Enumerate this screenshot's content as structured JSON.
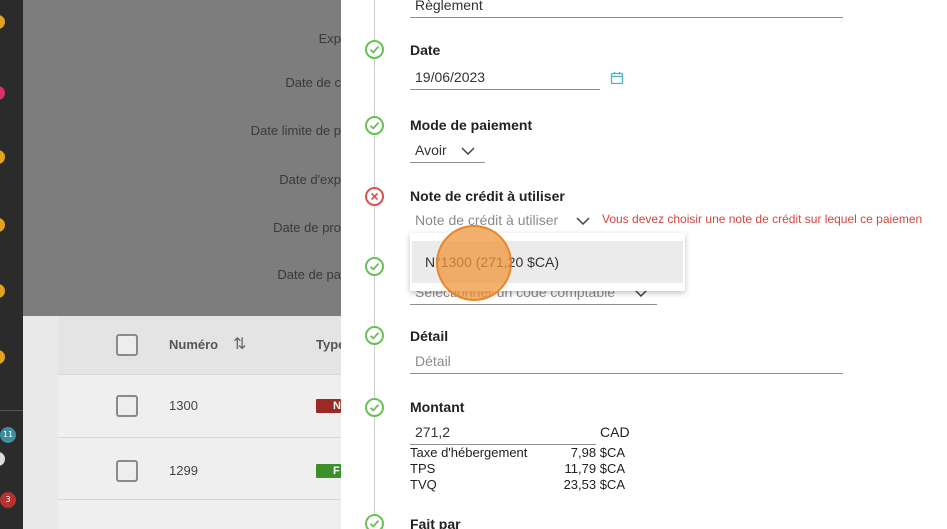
{
  "rail": {
    "badge_blue": "11",
    "badge_red": "3"
  },
  "background": {
    "labels": [
      "Exp",
      "Date de c",
      "Date limite de p",
      "Date d'exp",
      "Date de pro",
      "Date de pa"
    ],
    "table": {
      "headers": [
        "Numéro",
        "Type"
      ],
      "rows": [
        {
          "numero": "1300",
          "type": "Note"
        },
        {
          "numero": "1299",
          "type": "F"
        }
      ]
    }
  },
  "form": {
    "reglement_value": "Règlement",
    "date_label": "Date",
    "date_value": "19/06/2023",
    "mode_label": "Mode de paiement",
    "mode_value": "Avoir",
    "note_label": "Note de crédit à utiliser",
    "note_placeholder": "Note de crédit à utiliser",
    "note_error": "Vous devez choisir une note de crédit sur lequel ce paiemen",
    "code_placeholder": "Sélectionner un code comptable",
    "detail_label": "Détail",
    "detail_placeholder": "Détail",
    "montant_label": "Montant",
    "montant_value": "271,2",
    "currency": "CAD",
    "taxes": [
      {
        "name": "Taxe d'hébergement",
        "value": "7,98 $CA"
      },
      {
        "name": "TPS",
        "value": "11,79 $CA"
      },
      {
        "name": "TVQ",
        "value": "23,53 $CA"
      }
    ],
    "fait_par_label": "Fait par"
  },
  "dropdown": {
    "option": "N°1300 (271,20 $CA)"
  },
  "colors": {
    "success": "#6bbf59",
    "error": "#d9534f",
    "accent": "#4fb3c2"
  }
}
